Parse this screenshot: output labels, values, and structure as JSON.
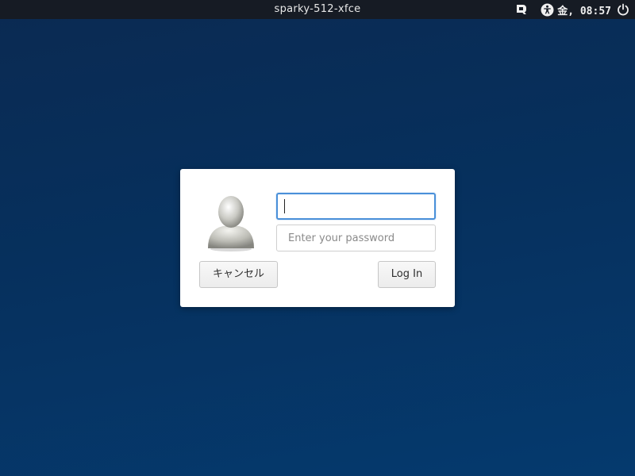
{
  "topbar": {
    "hostname": "sparky-512-xfce",
    "clock": "金, 08:57",
    "icons": [
      "keyboard-layout-icon",
      "accessibility-icon",
      "power-icon"
    ]
  },
  "login": {
    "username_value": "",
    "password_placeholder": "Enter your password",
    "cancel_label": "キャンセル",
    "login_label": "Log In"
  },
  "colors": {
    "topbar_bg": "#161b24",
    "desktop_bg": "#06305d",
    "focus_border": "#4a90d9"
  }
}
